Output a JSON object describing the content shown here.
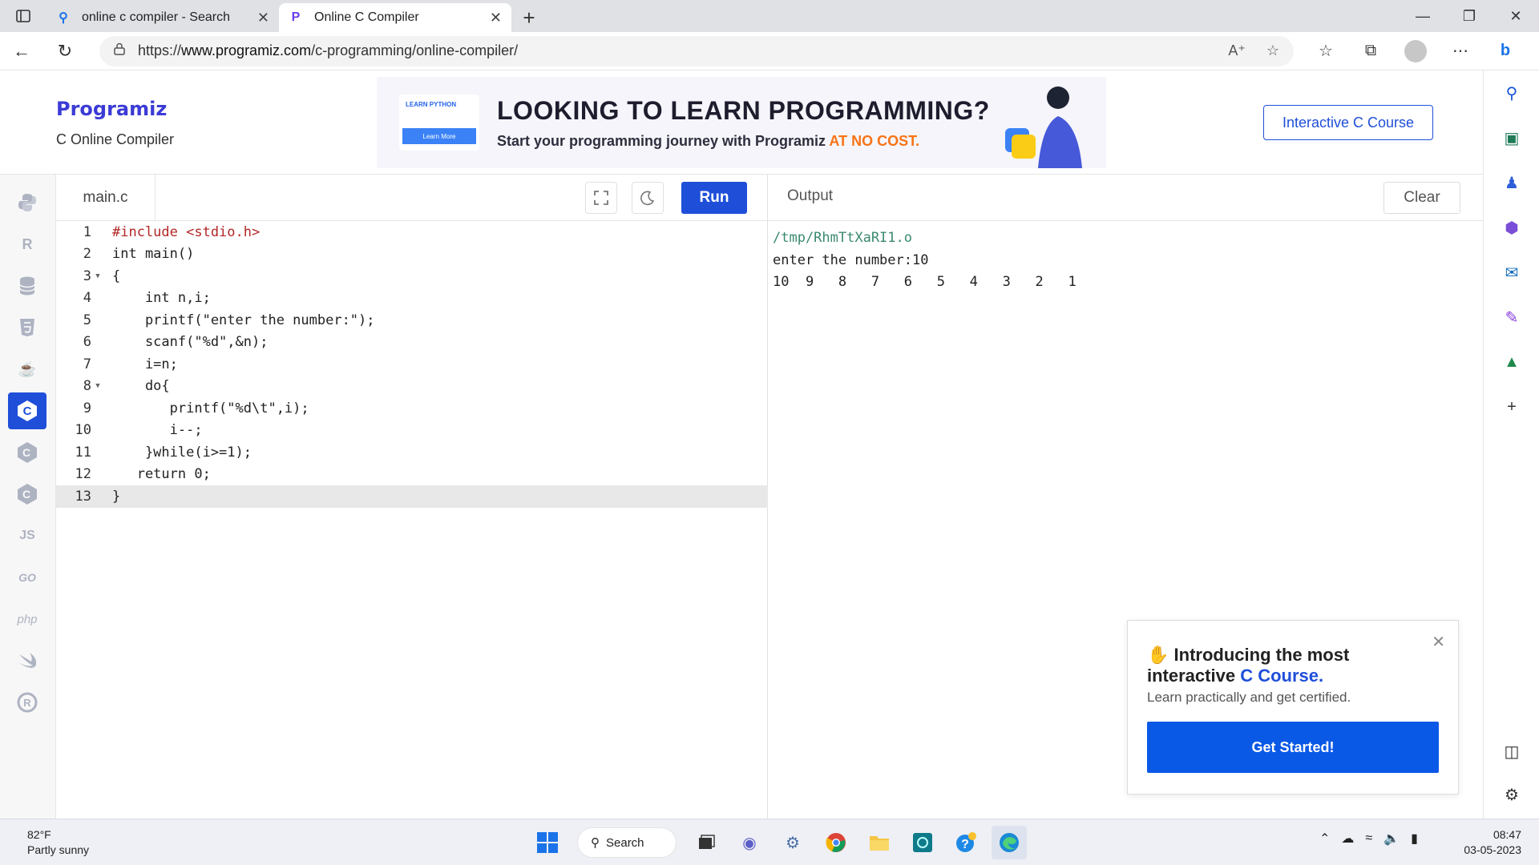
{
  "browser": {
    "tabs": [
      {
        "title": "online c compiler - Search",
        "active": false
      },
      {
        "title": "Online C Compiler",
        "active": true
      }
    ],
    "url_prefix": "https://",
    "url_domain": "www.programiz.com",
    "url_path": "/c-programming/online-compiler/"
  },
  "header": {
    "logo": "Programiz",
    "subtitle": "C Online Compiler",
    "banner_badge": "LEARN PYTHON",
    "banner_badge_button": "Learn More",
    "banner_headline": "LOOKING TO LEARN PROGRAMMING?",
    "banner_sub": "Start your programming journey with Programiz",
    "banner_sub_accent": "AT NO COST.",
    "course_button": "Interactive C Course"
  },
  "languages": [
    "python",
    "r",
    "sql",
    "html",
    "java",
    "c",
    "cpp",
    "csharp",
    "JS",
    "GO",
    "php",
    "swift",
    "rust"
  ],
  "editor": {
    "filename": "main.c",
    "run_label": "Run",
    "lines": [
      "#include <stdio.h>",
      "int main()",
      "{",
      "    int n,i;",
      "    printf(\"enter the number:\");",
      "    scanf(\"%d\",&n);",
      "    i=n;",
      "    do{",
      "       printf(\"%d\\t\",i);",
      "       i--;",
      "    }while(i>=1);",
      "   return 0;",
      "}"
    ]
  },
  "output": {
    "title": "Output",
    "clear_label": "Clear",
    "lines": [
      "/tmp/RhmTtXaRI1.o",
      "enter the number:10",
      "10\t9\t8\t7\t6\t5\t4\t3\t2\t1"
    ]
  },
  "popup": {
    "title_prefix": "Introducing the most interactive",
    "title_accent": "C Course.",
    "description": "Learn practically and get certified.",
    "button": "Get Started!"
  },
  "taskbar": {
    "temperature": "82°F",
    "weather": "Partly sunny",
    "search_label": "Search",
    "time": "08:47",
    "date": "03-05-2023"
  },
  "colors": {
    "primary": "#1f4fd9",
    "accent_orange": "#f97316",
    "brand_purple": "#6c3cf0"
  }
}
